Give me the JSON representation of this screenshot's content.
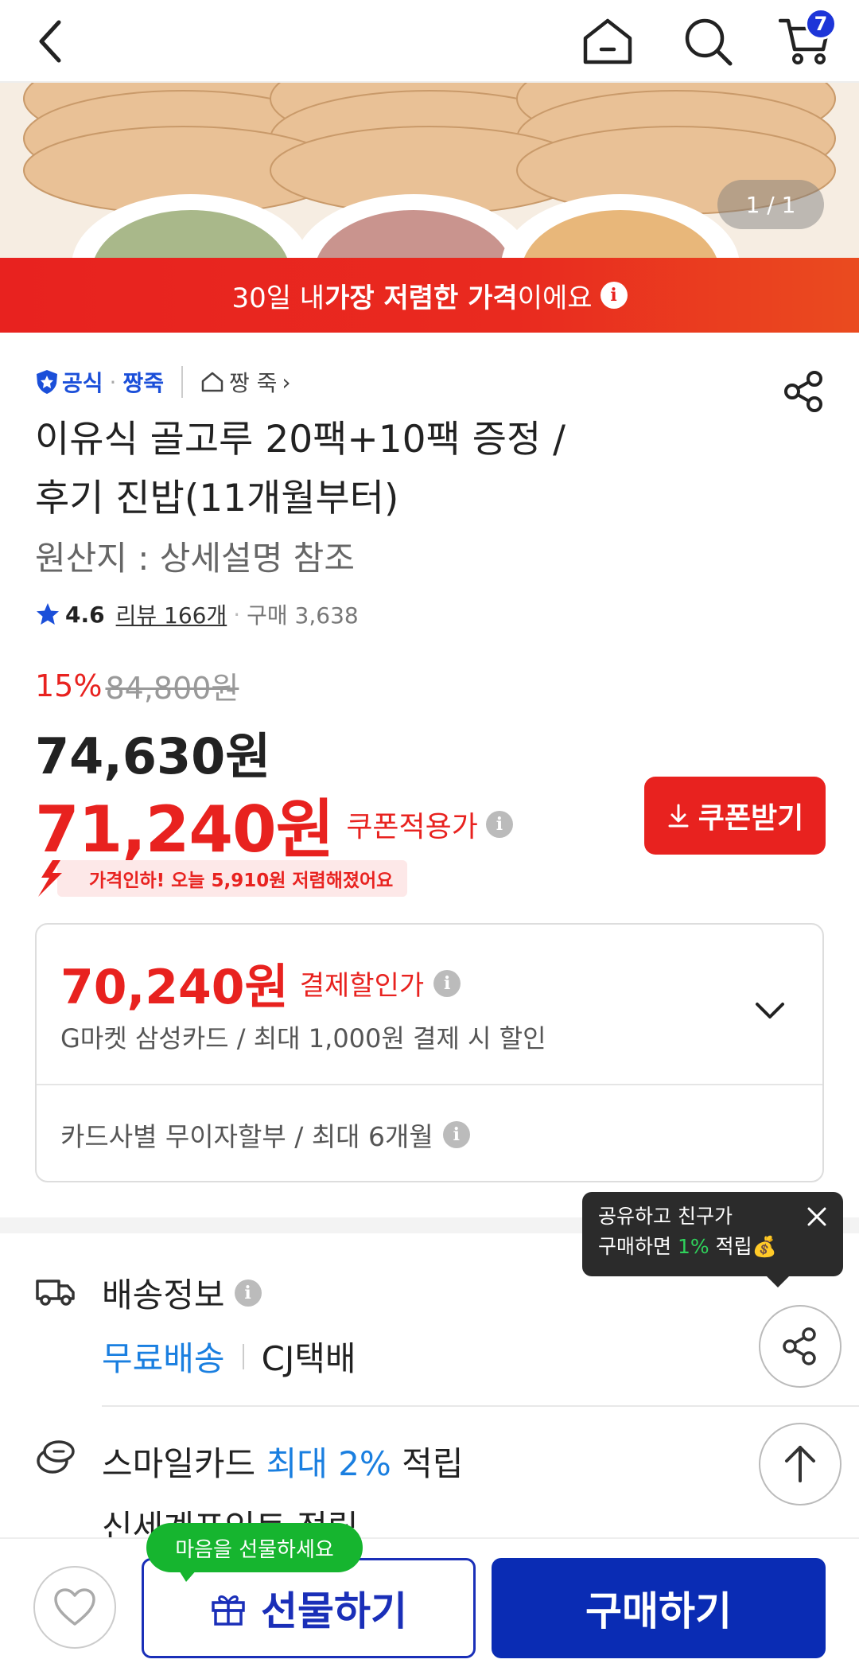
{
  "nav": {
    "cart_count": "7"
  },
  "hero": {
    "counter": "1 / 1"
  },
  "banner": {
    "pre": "30일 내 ",
    "bold": "가장 저렴한 가격",
    "post": "이에요",
    "info": "i"
  },
  "seller": {
    "official": "공식",
    "dot": "·",
    "name": "짱죽",
    "store": "짱 죽",
    "store_arrow": "›"
  },
  "product": {
    "title_line1": "이유식 골고루 20팩+10팩 증정 /",
    "title_line2": "후기 진밥(11개월부터)",
    "origin": "원산지 : 상세설명 참조"
  },
  "rating": {
    "score": "4.6",
    "reviews": "리뷰 166개",
    "sep": "·",
    "purchases": "구매 3,638"
  },
  "price": {
    "discount_pct": "15%",
    "original": "84,800원",
    "sale": "74,630원",
    "coupon_price": "71,240원",
    "coupon_label": "쿠폰적용가",
    "coupon_button": "쿠폰받기",
    "drop_notice": "가격인하! 오늘 5,910원 저렴해졌어요"
  },
  "payment": {
    "amount": "70,240원",
    "label": "결제할인가",
    "detail": "G마켓 삼성카드 / 최대 1,000원 결제 시 할인",
    "installment": "카드사별 무이자할부 / 최대 6개월"
  },
  "delivery": {
    "title": "배송정보",
    "free": "무료배송",
    "carrier": "CJ택배"
  },
  "smile": {
    "pre": "스마일카드 ",
    "highlight": "최대 2%",
    "post": " 적립"
  },
  "shinsegae": "신세계포인트 적립",
  "tooltip": {
    "line1": "공유하고 친구가",
    "line2_pre": "구매하면 ",
    "line2_green": "1%",
    "line2_post": " 적립💰"
  },
  "bottom": {
    "gift_bubble": "마음을 선물하세요",
    "gift": "선물하기",
    "buy": "구매하기"
  },
  "colors": {
    "accent_red": "#e8221f",
    "brand_blue": "#0a2cb4",
    "link_blue": "#1a7fe0",
    "green": "#16b52f"
  }
}
